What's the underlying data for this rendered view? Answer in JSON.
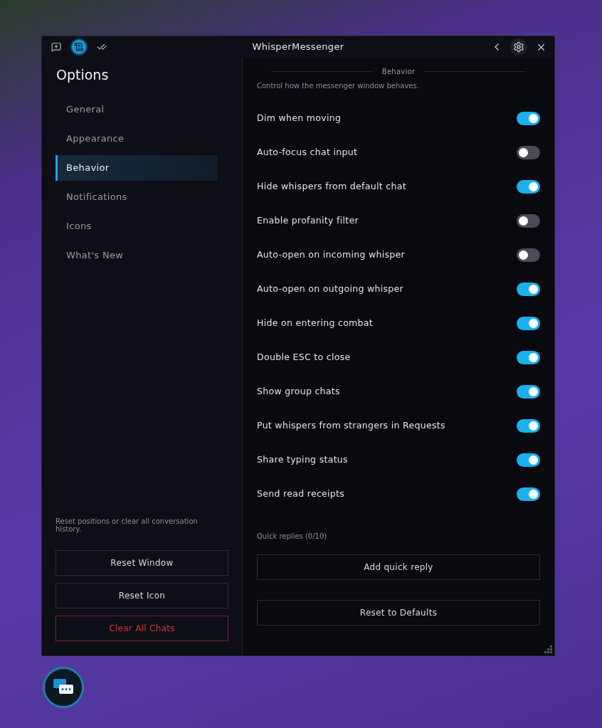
{
  "window": {
    "title": "WhisperMessenger"
  },
  "title_tabs": [
    {
      "kind": "chat",
      "selected": false
    },
    {
      "kind": "scroll",
      "selected": true
    },
    {
      "kind": "checks",
      "selected": false
    }
  ],
  "sidebar": {
    "title": "Options",
    "items": [
      {
        "label": "General",
        "selected": false
      },
      {
        "label": "Appearance",
        "selected": false
      },
      {
        "label": "Behavior",
        "selected": true
      },
      {
        "label": "Notifications",
        "selected": false
      },
      {
        "label": "Icons",
        "selected": false
      },
      {
        "label": "What's New",
        "selected": false
      }
    ],
    "footer_note": "Reset positions or clear all conversation history.",
    "buttons": [
      {
        "label": "Reset Window",
        "kind": "normal"
      },
      {
        "label": "Reset Icon",
        "kind": "normal"
      },
      {
        "label": "Clear All Chats",
        "kind": "danger"
      }
    ]
  },
  "section": {
    "heading": "Behavior",
    "description": "Control how the messenger window behaves.",
    "settings": [
      {
        "label": "Dim when moving",
        "on": true
      },
      {
        "label": "Auto-focus chat input",
        "on": false
      },
      {
        "label": "Hide whispers from default chat",
        "on": true
      },
      {
        "label": "Enable profanity filter",
        "on": false
      },
      {
        "label": "Auto-open on incoming whisper",
        "on": false
      },
      {
        "label": "Auto-open on outgoing whisper",
        "on": true
      },
      {
        "label": "Hide on entering combat",
        "on": true
      },
      {
        "label": "Double ESC to close",
        "on": true
      },
      {
        "label": "Show group chats",
        "on": true
      },
      {
        "label": "Put whispers from strangers in Requests",
        "on": true
      },
      {
        "label": "Share typing status",
        "on": true
      },
      {
        "label": "Send read receipts",
        "on": true
      }
    ],
    "quick_replies_label": "Quick replies (0/10)",
    "add_button": "Add quick reply",
    "reset_button": "Reset to Defaults"
  }
}
